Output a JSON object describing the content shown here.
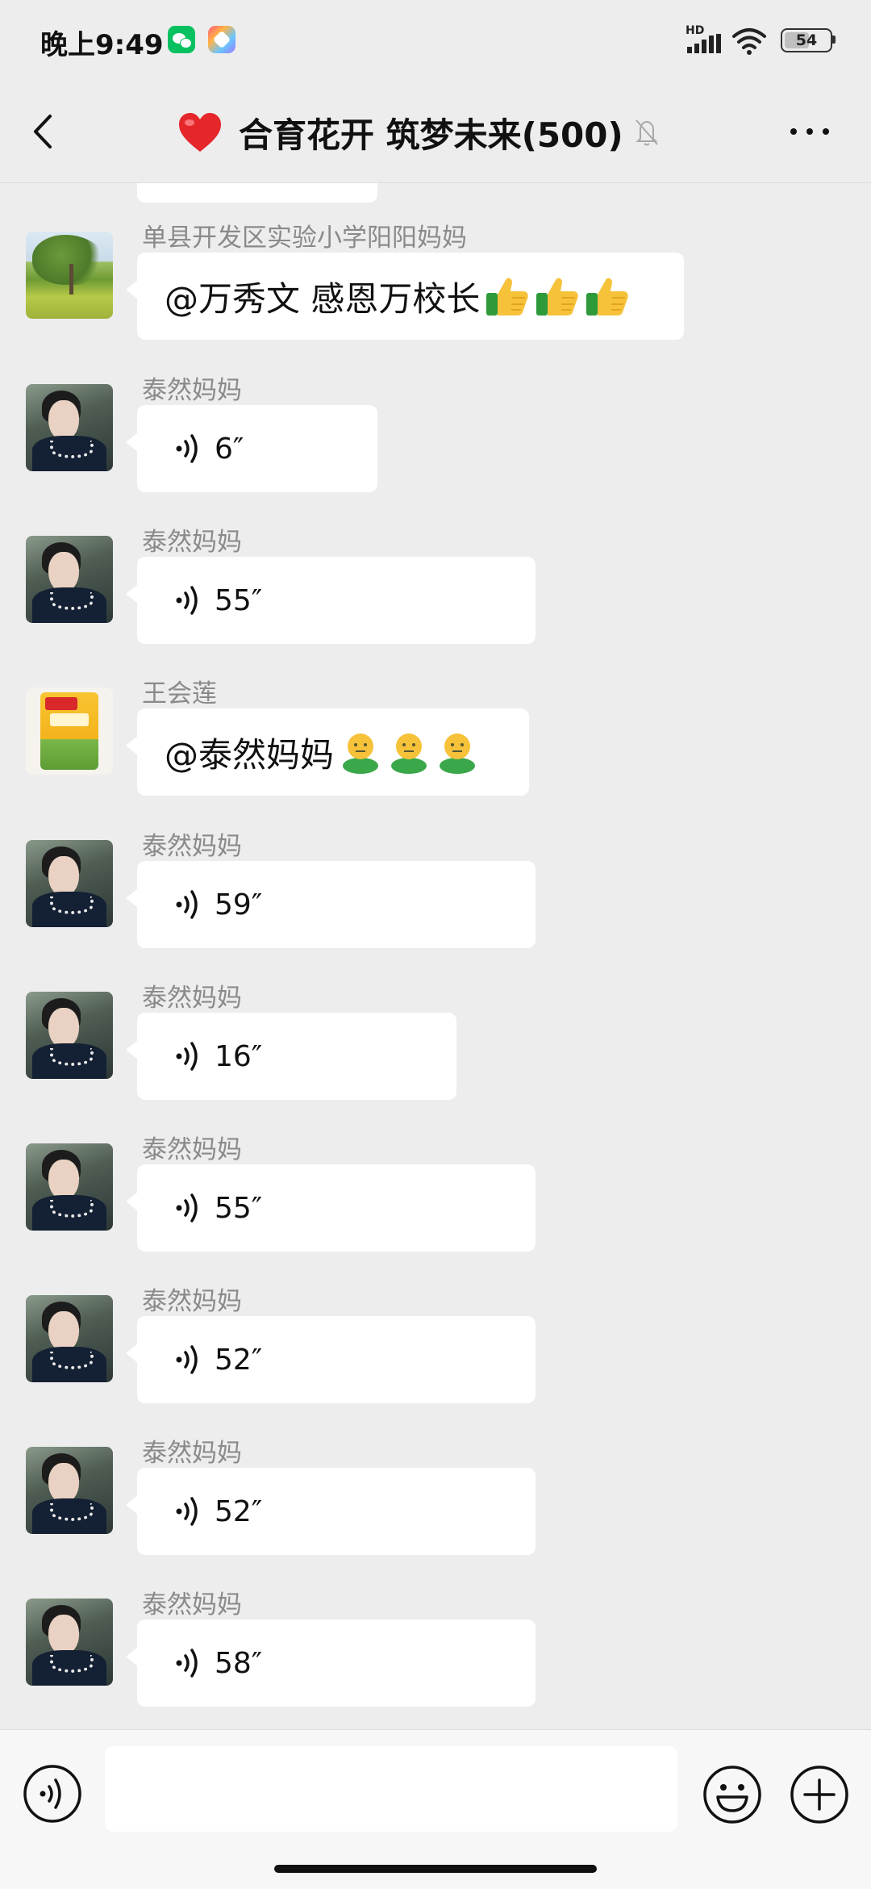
{
  "status_bar": {
    "time": "晚上9:49",
    "network_label": "HD",
    "battery": "54"
  },
  "header": {
    "title": "合育花开 筑梦未来(500)",
    "icons": [
      "back-icon",
      "heart-icon",
      "mute-icon",
      "more-icon"
    ]
  },
  "messages": [
    {
      "sender": "单县开发区实验小学阳阳妈妈",
      "type": "text",
      "text": "@万秀文  感恩万校长",
      "emoji": "thumbs-up",
      "emoji_count": 3
    },
    {
      "sender": "泰然妈妈",
      "type": "voice",
      "duration": "6″"
    },
    {
      "sender": "泰然妈妈",
      "type": "voice",
      "duration": "55″"
    },
    {
      "sender": "王会莲",
      "type": "text",
      "text": "@泰然妈妈 ",
      "emoji": "green-person",
      "emoji_count": 3
    },
    {
      "sender": "泰然妈妈",
      "type": "voice",
      "duration": "59″"
    },
    {
      "sender": "泰然妈妈",
      "type": "voice",
      "duration": "16″"
    },
    {
      "sender": "泰然妈妈",
      "type": "voice",
      "duration": "55″"
    },
    {
      "sender": "泰然妈妈",
      "type": "voice",
      "duration": "52″"
    },
    {
      "sender": "泰然妈妈",
      "type": "voice",
      "duration": "52″"
    },
    {
      "sender": "泰然妈妈",
      "type": "voice",
      "duration": "58″"
    }
  ],
  "input_bar": {
    "placeholder": "",
    "icons": [
      "voice-toggle-icon",
      "emoji-icon",
      "plus-icon"
    ]
  },
  "colors": {
    "background": "#ededed",
    "bubble": "#ffffff",
    "sender_name": "#8a8a8a",
    "wechat_green": "#07c160"
  }
}
